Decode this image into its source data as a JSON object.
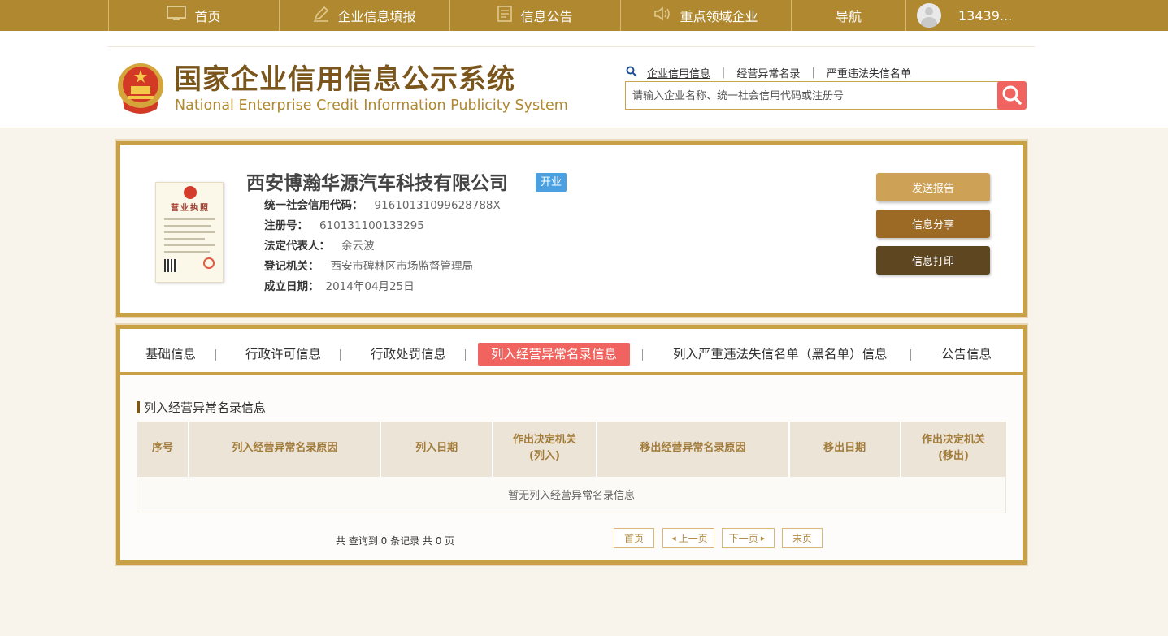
{
  "nav": {
    "items": [
      {
        "label": "首页",
        "icon": "monitor-icon"
      },
      {
        "label": "企业信息填报",
        "icon": "edit-icon"
      },
      {
        "label": "信息公告",
        "icon": "document-icon"
      },
      {
        "label": "重点领域企业",
        "icon": "speaker-icon"
      },
      {
        "label": "导航",
        "icon": ""
      }
    ],
    "user_label": "13439..."
  },
  "header": {
    "title": "国家企业信用信息公示系统",
    "subtitle": "National Enterprise Credit Information Publicity System",
    "search_links": [
      "企业信用信息",
      "经营异常名录",
      "严重违法失信名单"
    ],
    "search_placeholder": "请输入企业名称、统一社会信用代码或注册号"
  },
  "company": {
    "name": "西安博瀚华源汽车科技有限公司",
    "status": "开业",
    "license_title": "营业执照",
    "fields": [
      {
        "label": "统一社会信用代码：",
        "value": "91610131099628788X"
      },
      {
        "label": "注册号：",
        "value": "610131100133295"
      },
      {
        "label": "法定代表人：",
        "value": "余云波"
      },
      {
        "label": "登记机关：",
        "value": "西安市碑林区市场监督管理局"
      },
      {
        "label": "成立日期：",
        "value": "2014年04月25日"
      }
    ],
    "actions": [
      "发送报告",
      "信息分享",
      "信息打印"
    ]
  },
  "tabs": [
    "基础信息",
    "行政许可信息",
    "行政处罚信息",
    "列入经营异常名录信息",
    "列入严重违法失信名单（黑名单）信息",
    "公告信息"
  ],
  "active_tab": "列入经营异常名录信息",
  "section": {
    "title": "列入经营异常名录信息",
    "columns": [
      "序号",
      "列入经营异常名录原因",
      "列入日期",
      "作出决定机关\n(列入)",
      "移出经营异常名录原因",
      "移出日期",
      "作出决定机关\n(移出)"
    ],
    "empty_text": "暂无列入经营异常名录信息"
  },
  "pager": {
    "summary": "共 查询到 0 条记录 共 0 页",
    "first": "首页",
    "prev": "上一页",
    "next": "下一页",
    "last": "末页"
  },
  "colors": {
    "nav_bg": "#b0882f",
    "accent_red": "#f0635f",
    "gold_border": "#c9a045",
    "brown_dark": "#7a561c",
    "status_blue": "#4aa0e0",
    "btn_send": "#cda256",
    "btn_share": "#9c6a25",
    "btn_print": "#5e4620"
  }
}
